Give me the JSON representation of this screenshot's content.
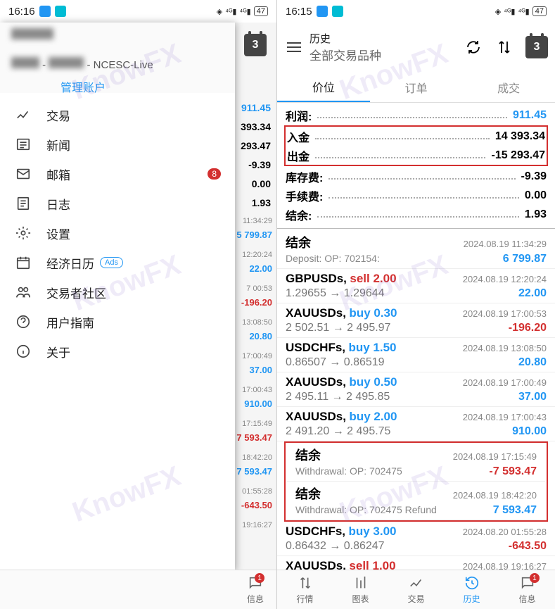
{
  "left": {
    "time": "16:16",
    "battery": "47",
    "account_server": "- NCESC-Live",
    "manage": "管理账户",
    "menu": [
      {
        "icon": "trade",
        "label": "交易"
      },
      {
        "icon": "news",
        "label": "新闻"
      },
      {
        "icon": "mail",
        "label": "邮箱",
        "badge": "8"
      },
      {
        "icon": "log",
        "label": "日志"
      },
      {
        "icon": "settings",
        "label": "设置"
      },
      {
        "icon": "calendar",
        "label": "经济日历",
        "ads": "Ads"
      },
      {
        "icon": "community",
        "label": "交易者社区"
      },
      {
        "icon": "help",
        "label": "用户指南"
      },
      {
        "icon": "about",
        "label": "关于"
      }
    ],
    "bg_cal": "3",
    "bg_summary": [
      "911.45",
      "393.34",
      "293.47",
      "-9.39",
      "0.00",
      "1.93"
    ],
    "bg_peek": [
      {
        "t": "11:34:29",
        "v": "5 799.87",
        "c": "blue"
      },
      {
        "t": "12:20:24",
        "v": "22.00",
        "c": "blue"
      },
      {
        "t": "7 00:53",
        "v": "-196.20",
        "c": "red"
      },
      {
        "t": "13:08:50",
        "v": "20.80",
        "c": "blue"
      },
      {
        "t": "17:00:49",
        "v": "37.00",
        "c": "blue"
      },
      {
        "t": "17:00:43",
        "v": "910.00",
        "c": "blue"
      },
      {
        "t": "17:15:49",
        "v": "7 593.47",
        "c": "red"
      },
      {
        "t": "18:42:20",
        "v": "7 593.47",
        "c": "blue"
      },
      {
        "t": "01:55:28",
        "v": "-643.50",
        "c": "red"
      },
      {
        "t": "19:16:27",
        "v": "",
        "c": ""
      }
    ],
    "nav": {
      "info": "信息",
      "badge": "1"
    }
  },
  "right": {
    "time": "16:15",
    "battery": "47",
    "title": "历史",
    "subtitle": "全部交易品种",
    "cal": "3",
    "tabs": [
      "价位",
      "订单",
      "成交"
    ],
    "summary": [
      {
        "label": "利润:",
        "val": "911.45",
        "blue": true
      },
      {
        "label": "入金",
        "val": "14 393.34",
        "hl": true
      },
      {
        "label": "出金",
        "val": "-15 293.47",
        "hl": true
      },
      {
        "label": "库存费:",
        "val": "-9.39"
      },
      {
        "label": "手续费:",
        "val": "0.00"
      },
      {
        "label": "结余:",
        "val": "1.93"
      }
    ],
    "trades": [
      {
        "type": "balance",
        "title": "结余",
        "sub": "Deposit: OP: 702154:",
        "time": "2024.08.19 11:34:29",
        "pnl": "6 799.87",
        "pos": true
      },
      {
        "sym": "GBPUSDs,",
        "act": "sell 2.00",
        "sell": true,
        "p": "1.29655 → 1.29644",
        "time": "2024.08.19 12:20:24",
        "pnl": "22.00",
        "pos": true
      },
      {
        "sym": "XAUUSDs,",
        "act": "buy 0.30",
        "p": "2 502.51 → 2 495.97",
        "time": "2024.08.19 17:00:53",
        "pnl": "-196.20"
      },
      {
        "sym": "USDCHFs,",
        "act": "buy 1.50",
        "p": "0.86507 → 0.86519",
        "time": "2024.08.19 13:08:50",
        "pnl": "20.80",
        "pos": true
      },
      {
        "sym": "XAUUSDs,",
        "act": "buy 0.50",
        "p": "2 495.11 → 2 495.85",
        "time": "2024.08.19 17:00:49",
        "pnl": "37.00",
        "pos": true
      },
      {
        "sym": "XAUUSDs,",
        "act": "buy 2.00",
        "p": "2 491.20 → 2 495.75",
        "time": "2024.08.19 17:00:43",
        "pnl": "910.00",
        "pos": true
      },
      {
        "type": "balance",
        "title": "结余",
        "sub": "Withdrawal:  OP: 702475",
        "time": "2024.08.19 17:15:49",
        "pnl": "-7 593.47",
        "hl": "top"
      },
      {
        "type": "balance",
        "title": "结余",
        "sub": "Withdrawal:  OP: 702475 Refund",
        "time": "2024.08.19 18:42:20",
        "pnl": "7 593.47",
        "pos": true,
        "hl": "bot"
      },
      {
        "sym": "USDCHFs,",
        "act": "buy 3.00",
        "p": "0.86432 → 0.86247",
        "time": "2024.08.20 01:55:28",
        "pnl": "-643.50"
      },
      {
        "sym": "XAUUSDs,",
        "act": "sell 1.00",
        "sell": true,
        "p": "",
        "time": "2024.08.19 19:16:27",
        "pnl": ""
      }
    ],
    "nav": [
      {
        "icon": "quotes",
        "label": "行情"
      },
      {
        "icon": "chart",
        "label": "图表"
      },
      {
        "icon": "trade",
        "label": "交易"
      },
      {
        "icon": "history",
        "label": "历史",
        "active": true
      },
      {
        "icon": "info",
        "label": "信息",
        "badge": "1"
      }
    ]
  },
  "watermark": "KnowFX"
}
